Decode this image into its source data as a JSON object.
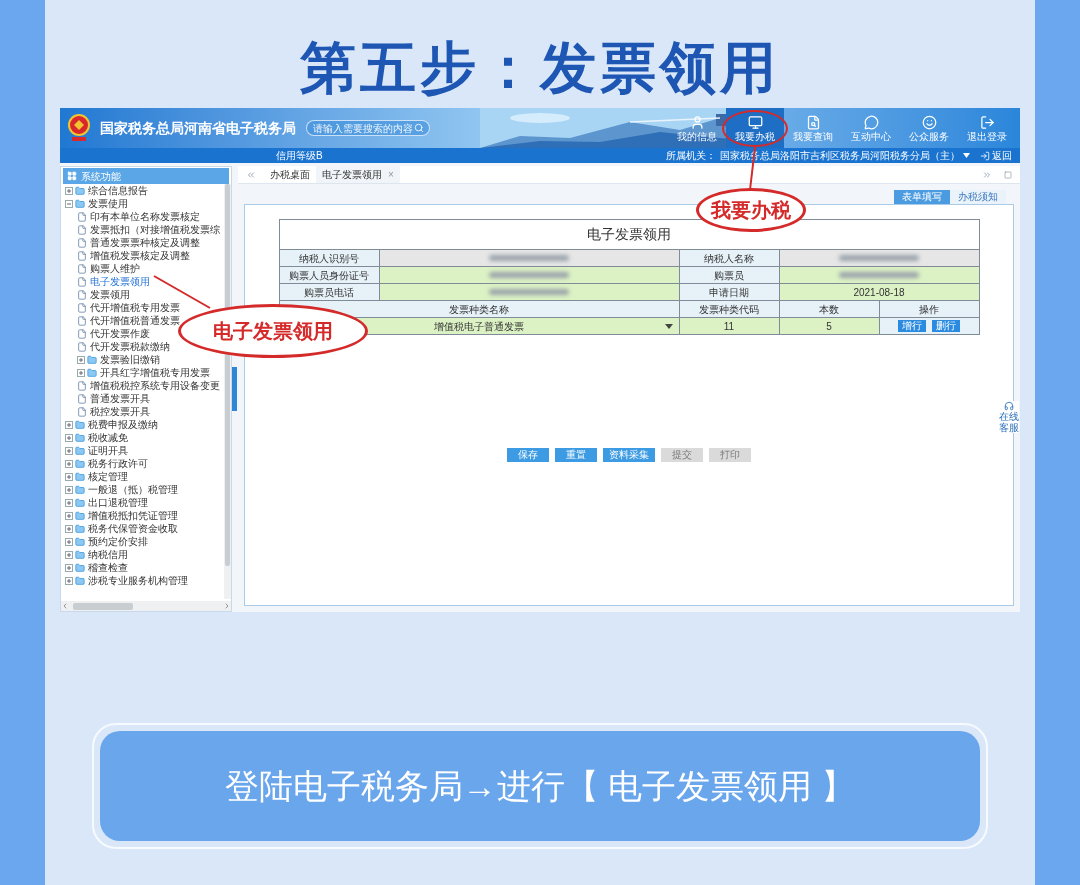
{
  "page_title": "第五步：发票领用",
  "app": {
    "header": {
      "site_title": "国家税务总局河南省电子税务局",
      "search": {
        "placeholder": "请输入需要搜索的内容"
      },
      "nav": [
        {
          "label": "我的信息",
          "selected": false
        },
        {
          "label": "我要办税",
          "selected": true
        },
        {
          "label": "我要查询",
          "selected": false
        },
        {
          "label": "互动中心",
          "selected": false
        },
        {
          "label": "公众服务",
          "selected": false
        },
        {
          "label": "退出登录",
          "selected": false
        }
      ]
    },
    "sub_bar": {
      "credit_level": "信用等级B",
      "org_label": "所属机关：",
      "org": "国家税务总局洛阳市吉利区税务局河阳税务分局（主）",
      "back": "返回"
    },
    "sidebar": {
      "title": "系统功能",
      "items": [
        {
          "kind": "folder",
          "label": "综合信息报告",
          "expanded": false,
          "selected": false
        },
        {
          "kind": "folder",
          "label": "发票使用",
          "expanded": true,
          "selected": false,
          "children": [
            {
              "kind": "file",
              "label": "印有本单位名称发票核定",
              "selected": false
            },
            {
              "kind": "file",
              "label": "发票抵扣（对接增值税发票综",
              "selected": false
            },
            {
              "kind": "file",
              "label": "普通发票票种核定及调整",
              "selected": false
            },
            {
              "kind": "file",
              "label": "增值税发票核定及调整",
              "selected": false
            },
            {
              "kind": "file",
              "label": "购票人维护",
              "selected": false
            },
            {
              "kind": "file",
              "label": "电子发票领用",
              "selected": true
            },
            {
              "kind": "file",
              "label": "发票领用",
              "selected": false
            },
            {
              "kind": "file",
              "label": "代开增值税专用发票",
              "selected": false
            },
            {
              "kind": "file",
              "label": "代开增值税普通发票",
              "selected": false
            },
            {
              "kind": "file",
              "label": "代开发票作废",
              "selected": false
            },
            {
              "kind": "file",
              "label": "代开发票税款缴纳",
              "selected": false
            },
            {
              "kind": "folder",
              "label": "发票验旧缴销",
              "expanded": false,
              "selected": false
            },
            {
              "kind": "folder",
              "label": "开具红字增值税专用发票",
              "expanded": false,
              "selected": false
            },
            {
              "kind": "file",
              "label": "增值税税控系统专用设备变更",
              "selected": false
            },
            {
              "kind": "file",
              "label": "普通发票开具",
              "selected": false
            },
            {
              "kind": "file",
              "label": "税控发票开具",
              "selected": false
            }
          ]
        },
        {
          "kind": "folder",
          "label": "税费申报及缴纳",
          "expanded": false,
          "selected": false
        },
        {
          "kind": "folder",
          "label": "税收减免",
          "expanded": false,
          "selected": false
        },
        {
          "kind": "folder",
          "label": "证明开具",
          "expanded": false,
          "selected": false
        },
        {
          "kind": "folder",
          "label": "税务行政许可",
          "expanded": false,
          "selected": false
        },
        {
          "kind": "folder",
          "label": "核定管理",
          "expanded": false,
          "selected": false
        },
        {
          "kind": "folder",
          "label": "一般退（抵）税管理",
          "expanded": false,
          "selected": false
        },
        {
          "kind": "folder",
          "label": "出口退税管理",
          "expanded": false,
          "selected": false
        },
        {
          "kind": "folder",
          "label": "增值税抵扣凭证管理",
          "expanded": false,
          "selected": false
        },
        {
          "kind": "folder",
          "label": "税务代保管资金收取",
          "expanded": false,
          "selected": false
        },
        {
          "kind": "folder",
          "label": "预约定价安排",
          "expanded": false,
          "selected": false
        },
        {
          "kind": "folder",
          "label": "纳税信用",
          "expanded": false,
          "selected": false
        },
        {
          "kind": "folder",
          "label": "稽查检查",
          "expanded": false,
          "selected": false
        },
        {
          "kind": "folder",
          "label": "涉税专业服务机构管理",
          "expanded": false,
          "selected": false
        }
      ]
    },
    "tabs": [
      {
        "label": "办税桌面",
        "selected": false
      },
      {
        "label": "电子发票领用",
        "selected": true,
        "close": "×"
      }
    ],
    "form_tabs": [
      {
        "label": "表单填写",
        "selected": true
      },
      {
        "label": "办税须知",
        "selected": false
      }
    ],
    "form": {
      "title": "电子发票领用",
      "info_rows": [
        {
          "cells": [
            {
              "kind": "label",
              "text": "纳税人识别号"
            },
            {
              "kind": "redacted",
              "readonly": true
            },
            {
              "kind": "label",
              "text": "纳税人名称"
            },
            {
              "kind": "redacted",
              "readonly": true
            }
          ]
        },
        {
          "cells": [
            {
              "kind": "label",
              "text": "购票人员身份证号"
            },
            {
              "kind": "redacted",
              "readonly": false
            },
            {
              "kind": "label",
              "text": "购票员"
            },
            {
              "kind": "redacted",
              "readonly": false
            }
          ]
        },
        {
          "cells": [
            {
              "kind": "label",
              "text": "购票员电话"
            },
            {
              "kind": "redacted",
              "readonly": false
            },
            {
              "kind": "label",
              "text": "申请日期"
            },
            {
              "kind": "value",
              "text": "2021-08-18",
              "readonly": false
            }
          ]
        }
      ],
      "columns": [
        "发票种类名称",
        "发票种类代码",
        "本数",
        "操作"
      ],
      "rows": [
        {
          "name": "增值税电子普通发票",
          "code": "11",
          "count": "5",
          "actions": [
            "增行",
            "删行"
          ]
        }
      ]
    },
    "buttons": [
      {
        "label": "保存",
        "disabled": false
      },
      {
        "label": "重置",
        "disabled": false
      },
      {
        "label": "资料采集",
        "disabled": false
      },
      {
        "label": "提交",
        "disabled": true
      },
      {
        "label": "打印",
        "disabled": true
      }
    ],
    "online_service": "在线客服"
  },
  "callouts": [
    {
      "label": "我要办税"
    },
    {
      "label": "电子发票领用"
    }
  ],
  "caption": "登陆电子税务局→进行【 电子发票领用 】"
}
